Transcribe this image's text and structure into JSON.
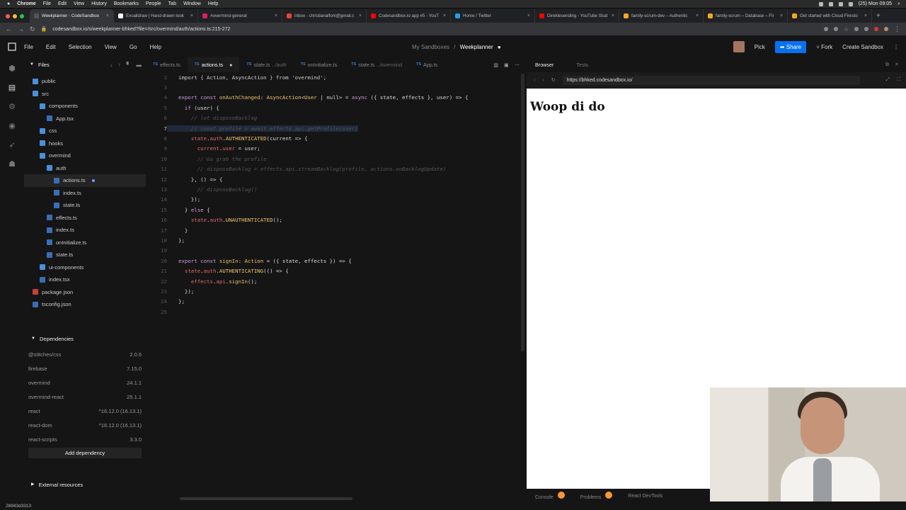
{
  "macbar": {
    "app": "Chrome",
    "menus": [
      "File",
      "Edit",
      "View",
      "History",
      "Bookmarks",
      "People",
      "Tab",
      "Window",
      "Help"
    ],
    "clock": "(25) Mon 09:05"
  },
  "browser_tabs": [
    {
      "title": "Weekplanner - CodeSandbox",
      "active": true,
      "color": "#555555"
    },
    {
      "title": "Excalidraw | Hand-drawn look",
      "color": "#ffffff"
    },
    {
      "title": "#overmind-general",
      "color": "#e01e5a"
    },
    {
      "title": "Inbox - christianalfoni@gmail.c",
      "color": "#e94235"
    },
    {
      "title": "Codesandbox.io app #5 - YouT",
      "color": "#ff0000"
    },
    {
      "title": "Home / Twitter",
      "color": "#1da1f2"
    },
    {
      "title": "Direktesending - YouTube Stud",
      "color": "#ff0000"
    },
    {
      "title": "family-scrum-dev – Authentic",
      "color": "#f5a623"
    },
    {
      "title": "family-scrum – Database – Fir",
      "color": "#f5a623"
    },
    {
      "title": "Get started with Cloud Firesto",
      "color": "#f5a623"
    }
  ],
  "address_bar": {
    "url": "codesandbox.io/s/weekplanner-bhked?file=/src/overmind/auth/actions.ts:215-272"
  },
  "header": {
    "menu": [
      "File",
      "Edit",
      "Selection",
      "View",
      "Go",
      "Help"
    ],
    "breadcrumb_root": "My Sandboxes",
    "separator": "/",
    "project": "Weekplanner",
    "pick": "Pick",
    "share": "Share",
    "fork": "Fork",
    "create": "Create Sandbox"
  },
  "sidebar": {
    "title": "Files",
    "tree": [
      {
        "name": "public",
        "type": "folder",
        "depth": 1
      },
      {
        "name": "src",
        "type": "folder",
        "depth": 1
      },
      {
        "name": "components",
        "type": "folder",
        "depth": 2
      },
      {
        "name": "App.tsx",
        "type": "ts",
        "depth": 3
      },
      {
        "name": "css",
        "type": "folder",
        "depth": 2
      },
      {
        "name": "hooks",
        "type": "folder",
        "depth": 2
      },
      {
        "name": "overmind",
        "type": "folder",
        "depth": 2
      },
      {
        "name": "auth",
        "type": "folder",
        "depth": 3
      },
      {
        "name": "actions.ts",
        "type": "ts",
        "depth": 4,
        "selected": true,
        "modified": true
      },
      {
        "name": "index.ts",
        "type": "ts",
        "depth": 4
      },
      {
        "name": "state.ts",
        "type": "ts",
        "depth": 4
      },
      {
        "name": "effects.ts",
        "type": "ts",
        "depth": 3
      },
      {
        "name": "index.ts",
        "type": "ts",
        "depth": 3
      },
      {
        "name": "onInitialize.ts",
        "type": "ts",
        "depth": 3
      },
      {
        "name": "state.ts",
        "type": "ts",
        "depth": 3
      },
      {
        "name": "ui-components",
        "type": "folder",
        "depth": 2
      },
      {
        "name": "index.tsx",
        "type": "ts",
        "depth": 2
      },
      {
        "name": "package.json",
        "type": "json",
        "depth": 1
      },
      {
        "name": "tsconfig.json",
        "type": "ts",
        "depth": 1
      }
    ],
    "dependencies_title": "Dependencies",
    "dependencies": [
      {
        "name": "@stitches/css",
        "version": "2.0.6"
      },
      {
        "name": "firebase",
        "version": "7.15.0"
      },
      {
        "name": "overmind",
        "version": "24.1.1"
      },
      {
        "name": "overmind-react",
        "version": "25.1.1"
      },
      {
        "name": "react",
        "version": "^16.12.0 (16.13.1)"
      },
      {
        "name": "react-dom",
        "version": "^16.12.0 (16.13.1)"
      },
      {
        "name": "react-scripts",
        "version": "3.3.0"
      }
    ],
    "add_dependency": "Add dependency",
    "external_resources": "External resources"
  },
  "editor_tabs": [
    {
      "name": "effects.ts",
      "path": ""
    },
    {
      "name": "actions.ts",
      "path": "",
      "active": true,
      "modified": true
    },
    {
      "name": "state.ts",
      "path": "../auth",
      "italic": true
    },
    {
      "name": "onInitialize.ts",
      "path": ""
    },
    {
      "name": "state.ts",
      "path": "../overmind"
    },
    {
      "name": "App.ts",
      "path": ""
    }
  ],
  "code_lines": [
    {
      "n": "2",
      "html": "<span class='o'>import { Action, AsyncAction } from 'overmind';</span>"
    },
    {
      "n": "3",
      "html": ""
    },
    {
      "n": "4",
      "html": "<span class='k'>export const</span> <span class='f'>onAuthChanged</span>: <span class='t'>AsyncAction</span>&lt;<span class='t'>User</span> | null&gt; = <span class='k'>async</span> ({ state, effects }, user) =&gt; {"
    },
    {
      "n": "5",
      "html": "  <span class='k'>if</span> (user) {"
    },
    {
      "n": "6",
      "html": "    <span class='c'>// let disposeBacklog</span>"
    },
    {
      "n": "7",
      "html": "    <span class='c'>// const profile = await effects.api.getProfile(user)</span>",
      "current": true
    },
    {
      "n": "8",
      "html": "    <span class='p'>state</span>.<span class='p'>auth</span>.<span class='t'>AUTHENTICATED</span>(current =&gt; {"
    },
    {
      "n": "9",
      "html": "      <span class='p'>current</span>.<span class='p'>user</span> = user;"
    },
    {
      "n": "10",
      "html": "      <span class='c'>// Go grab the profile</span>"
    },
    {
      "n": "11",
      "html": "      <span class='c'>// disposeBacklog = effects.api.streamBacklog(profile, actions.onBacklogUpdate)</span>"
    },
    {
      "n": "12",
      "html": "    }, () =&gt; {  "
    },
    {
      "n": "13",
      "html": "      <span class='c'>// disposeBacklog()</span>"
    },
    {
      "n": "14",
      "html": "    });"
    },
    {
      "n": "15",
      "html": "  } <span class='k'>else</span> {"
    },
    {
      "n": "16",
      "html": "    <span class='p'>state</span>.<span class='p'>auth</span>.<span class='t'>UNAUTHENTICATED</span>();"
    },
    {
      "n": "17",
      "html": "  }"
    },
    {
      "n": "18",
      "html": "};"
    },
    {
      "n": "19",
      "html": ""
    },
    {
      "n": "20",
      "html": "<span class='k'>export const</span> <span class='f'>signIn</span>: <span class='t'>Action</span> = ({ state, effects }) =&gt; {"
    },
    {
      "n": "21",
      "html": "  <span class='p'>state</span>.<span class='p'>auth</span>.<span class='t'>AUTHENTICATING</span>(() =&gt; {"
    },
    {
      "n": "22",
      "html": "    <span class='p'>effects</span>.<span class='p'>api</span>.<span class='f'>signIn</span>();"
    },
    {
      "n": "23",
      "html": "  });"
    },
    {
      "n": "24",
      "html": "};"
    },
    {
      "n": "25",
      "html": ""
    }
  ],
  "preview": {
    "tab_browser": "Browser",
    "tab_tests": "Tests",
    "url": "https://bhked.codesandbox.io/",
    "heading": "Woop di do",
    "console": "Console",
    "problems": "Problems",
    "devtools": "React DevTools"
  },
  "status_bar": {
    "text": "26943d3313"
  }
}
